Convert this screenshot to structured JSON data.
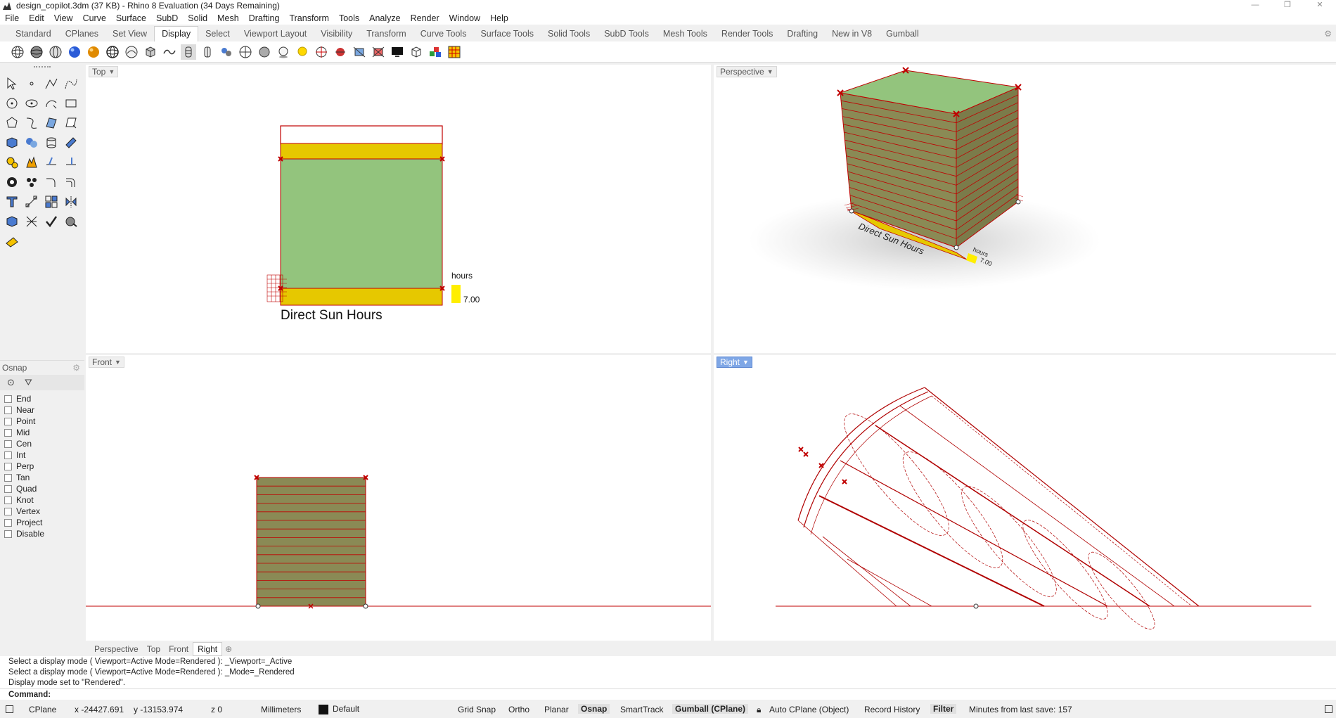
{
  "window": {
    "title": "design_copilot.3dm (37 KB) - Rhino 8 Evaluation (34 Days Remaining)",
    "icon": "rhino-icon"
  },
  "menu": [
    "File",
    "Edit",
    "View",
    "Curve",
    "Surface",
    "SubD",
    "Solid",
    "Mesh",
    "Drafting",
    "Transform",
    "Tools",
    "Analyze",
    "Render",
    "Window",
    "Help"
  ],
  "tabs": [
    "Standard",
    "CPlanes",
    "Set View",
    "Display",
    "Select",
    "Viewport Layout",
    "Visibility",
    "Transform",
    "Curve Tools",
    "Surface Tools",
    "Solid Tools",
    "SubD Tools",
    "Mesh Tools",
    "Render Tools",
    "Drafting",
    "New in V8",
    "Gumball"
  ],
  "active_tab": "Display",
  "toolbar_icons": [
    "wireframe-sphere-icon",
    "shaded-sphere-icon",
    "ghosted-sphere-icon",
    "rendered-sphere-icon",
    "raytraced-sphere-icon",
    "technical-sphere-icon",
    "artistic-sphere-icon",
    "xray-box-icon",
    "pen-mode-icon",
    "isocurve-icon",
    "shade-toggle-icon",
    "point-light-icon",
    "cplane-grid-icon",
    "mesh-sphere-icon",
    "shadow-sphere-icon",
    "light-bulb-icon",
    "target-icon",
    "camera-icon",
    "clipping-plane-icon",
    "crop-icon",
    "monitor-icon",
    "box-view-icon",
    "color-cubes-icon",
    "grid-color-icon"
  ],
  "left_tools": [
    "select-arrow-icon",
    "point-icon",
    "polyline-icon",
    "curve-icon",
    "circle-icon",
    "ellipse-icon",
    "arc-icon",
    "rectangle-icon",
    "polygon-icon",
    "free-curve-icon",
    "surface-icon",
    "patch-icon",
    "box-icon",
    "spheres-icon",
    "cylinder-icon",
    "extrude-icon",
    "gear-tool-icon",
    "explode-icon",
    "trim-icon",
    "split-icon",
    "boolean-icon",
    "group-icon",
    "fillet-icon",
    "offset-icon",
    "text-icon",
    "dimension-icon",
    "array-icon",
    "mirror-icon",
    "block-icon",
    "hatch-icon",
    "check-icon",
    "analyze-icon",
    "highlight-icon"
  ],
  "osnap": {
    "title": "Osnap",
    "items": [
      "End",
      "Near",
      "Point",
      "Mid",
      "Cen",
      "Int",
      "Perp",
      "Tan",
      "Quad",
      "Knot",
      "Vertex",
      "Project",
      "Disable"
    ]
  },
  "viewports": {
    "top": "Top",
    "perspective": "Perspective",
    "front": "Front",
    "right": "Right",
    "active": "Right"
  },
  "scene": {
    "title_label": "Direct Sun Hours",
    "legend_unit": "hours",
    "legend_value": "7.00",
    "colors": {
      "roof": "#93c47d",
      "wall": "#8a8a55",
      "sun": "#e6c800",
      "legend": "#ffee00",
      "edge": "#c00000"
    }
  },
  "viewport_tabs": [
    "Perspective",
    "Top",
    "Front",
    "Right"
  ],
  "command_history": [
    "Select a display mode ( Viewport=Active  Mode=Rendered ): _Viewport=_Active",
    "Select a display mode ( Viewport=Active  Mode=Rendered ): _Mode=_Rendered",
    "Display mode set to \"Rendered\"."
  ],
  "command_label": "Command:",
  "status": {
    "cplane": "CPlane",
    "x": "x -24427.691",
    "y": "y -13153.974",
    "z": "z 0",
    "units": "Millimeters",
    "layer": "Default",
    "grid_snap": "Grid Snap",
    "ortho": "Ortho",
    "planar": "Planar",
    "osnap": "Osnap",
    "smarttrack": "SmartTrack",
    "gumball": "Gumball (CPlane)",
    "auto_cplane": "Auto CPlane (Object)",
    "record_history": "Record History",
    "filter": "Filter",
    "save_info": "Minutes from last save: 157"
  }
}
